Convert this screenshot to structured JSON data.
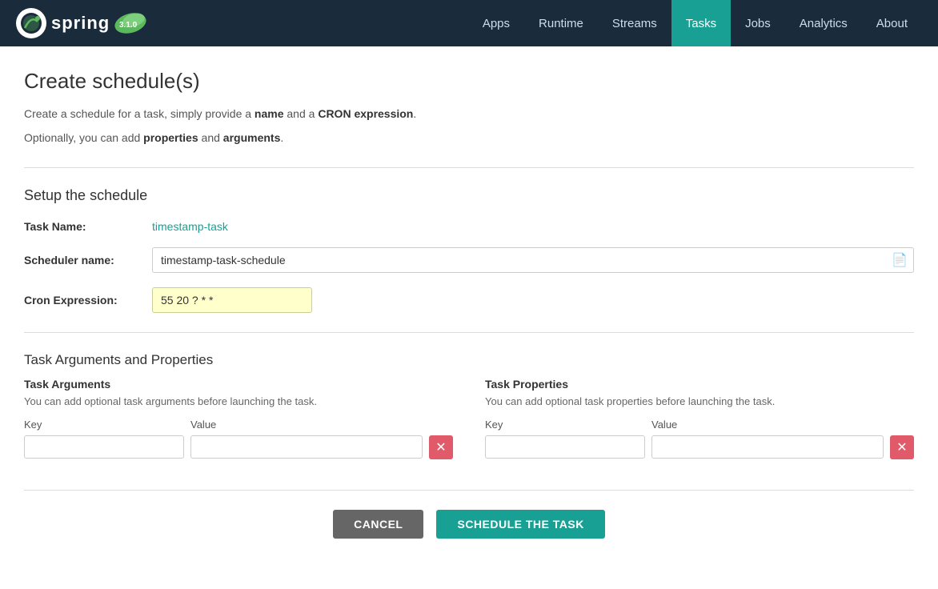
{
  "nav": {
    "logo_text": "spring",
    "items": [
      {
        "label": "Apps",
        "active": false
      },
      {
        "label": "Runtime",
        "active": false
      },
      {
        "label": "Streams",
        "active": false
      },
      {
        "label": "Tasks",
        "active": true
      },
      {
        "label": "Jobs",
        "active": false
      },
      {
        "label": "Analytics",
        "active": false
      },
      {
        "label": "About",
        "active": false
      }
    ]
  },
  "page": {
    "title": "Create schedule(s)",
    "intro_line1_pre": "Create a schedule for a task, simply provide a ",
    "intro_bold1": "name",
    "intro_line1_mid": " and a ",
    "intro_bold2": "CRON expression",
    "intro_line1_post": ".",
    "intro_line2_pre": "Optionally, you can add ",
    "intro_bold3": "properties",
    "intro_line2_mid": " and ",
    "intro_bold4": "arguments",
    "intro_line2_post": "."
  },
  "schedule_section": {
    "title": "Setup the schedule",
    "task_name_label": "Task Name:",
    "task_name_value": "timestamp-task",
    "scheduler_name_label": "Scheduler name:",
    "scheduler_name_value": "timestamp-task-schedule",
    "scheduler_name_placeholder": "",
    "cron_label": "Cron Expression:",
    "cron_value": "55 20 ? * *"
  },
  "args_props_section": {
    "title": "Task Arguments and Properties",
    "args_title": "Task Arguments",
    "args_desc": "You can add optional task arguments before launching the task.",
    "args_key_header": "Key",
    "args_val_header": "Value",
    "props_title": "Task Properties",
    "props_desc": "You can add optional task properties before launching the task.",
    "props_key_header": "Key",
    "props_val_header": "Value"
  },
  "footer": {
    "cancel_label": "CANCEL",
    "schedule_label": "SCHEDULE THE TASK"
  }
}
